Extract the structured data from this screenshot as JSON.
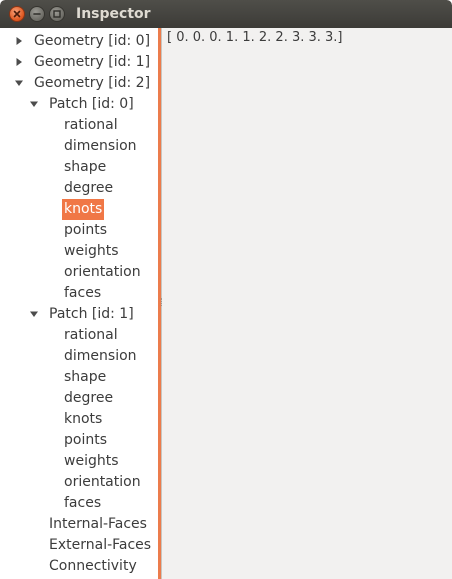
{
  "window": {
    "title": "Inspector",
    "controls": [
      "close",
      "minimize",
      "maximize"
    ]
  },
  "detail": {
    "value_text": "[ 0.  0.  0.  1.  1.  2.  2.  3.  3.  3.]"
  },
  "tree": {
    "selected": "knots",
    "nodes": [
      {
        "label": "Geometry [id: 0]",
        "depth": 0,
        "expander": "collapsed"
      },
      {
        "label": "Geometry [id: 1]",
        "depth": 0,
        "expander": "collapsed"
      },
      {
        "label": "Geometry [id: 2]",
        "depth": 0,
        "expander": "expanded"
      },
      {
        "label": "Patch [id: 0]",
        "depth": 1,
        "expander": "expanded"
      },
      {
        "label": "rational",
        "depth": 2
      },
      {
        "label": "dimension",
        "depth": 2
      },
      {
        "label": "shape",
        "depth": 2
      },
      {
        "label": "degree",
        "depth": 2
      },
      {
        "label": "knots",
        "depth": 2,
        "selected": true
      },
      {
        "label": "points",
        "depth": 2
      },
      {
        "label": "weights",
        "depth": 2
      },
      {
        "label": "orientation",
        "depth": 2
      },
      {
        "label": "faces",
        "depth": 2
      },
      {
        "label": "Patch [id: 1]",
        "depth": 1,
        "expander": "expanded"
      },
      {
        "label": "rational",
        "depth": 2
      },
      {
        "label": "dimension",
        "depth": 2
      },
      {
        "label": "shape",
        "depth": 2
      },
      {
        "label": "degree",
        "depth": 2
      },
      {
        "label": "knots",
        "depth": 2
      },
      {
        "label": "points",
        "depth": 2
      },
      {
        "label": "weights",
        "depth": 2
      },
      {
        "label": "orientation",
        "depth": 2
      },
      {
        "label": "faces",
        "depth": 2
      },
      {
        "label": "Internal-Faces",
        "depth": 1
      },
      {
        "label": "External-Faces",
        "depth": 1
      },
      {
        "label": "Connectivity",
        "depth": 1
      }
    ]
  },
  "colors": {
    "selection": "#f07746",
    "scroll_indicator": "#ec7c4c",
    "titlebar": "#3c3b37"
  }
}
